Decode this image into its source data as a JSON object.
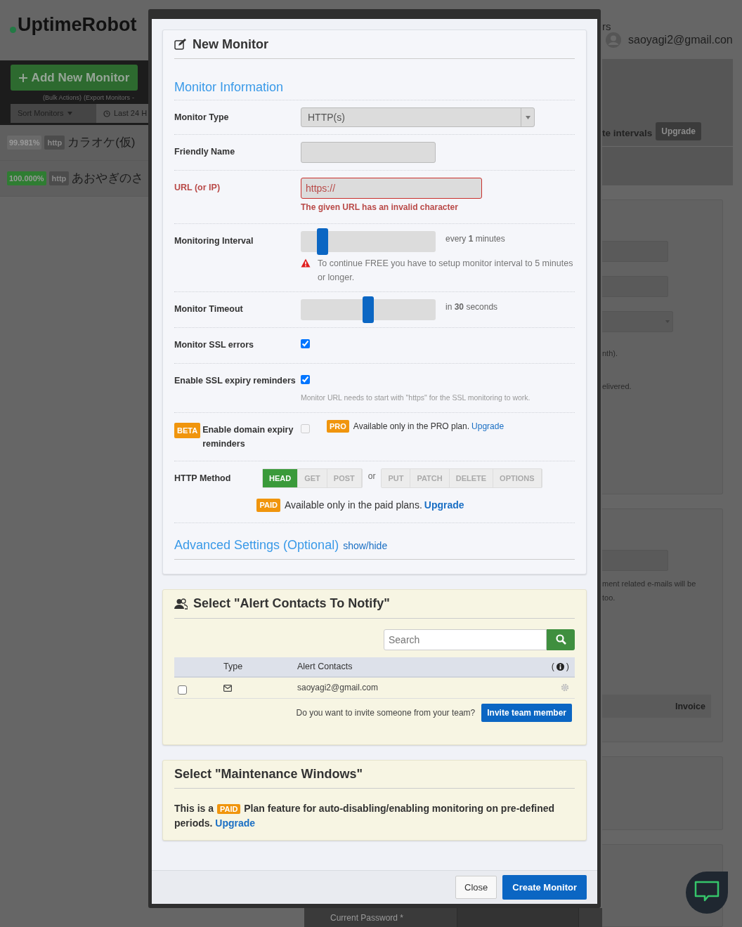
{
  "background": {
    "logo": "UptimeRobot",
    "add_button": "Add New Monitor",
    "links": [
      "(Bulk Actions)",
      "(Export Monitors"
    ],
    "link_separator": "-",
    "sort_label": "Sort Monitors",
    "range_label": "Last 24 H",
    "monitors": [
      {
        "uptime": "99.981%",
        "type": "http",
        "name": "カラオケ(仮)",
        "color": "#6a6a6a"
      },
      {
        "uptime": "100.000%",
        "type": "http",
        "name": "あおやぎのさ",
        "color": "#2f7d32"
      }
    ],
    "header_fragment": "rs",
    "user_email": "saoyagi2@gmail.con",
    "notice": "te intervals",
    "notice_button": "Upgrade",
    "fragments": [
      "nth).",
      "elivered.",
      "ment related e-mails will be",
      "too."
    ],
    "invoice": "Invoice",
    "current_password": "Current Password *"
  },
  "modal": {
    "title": "New Monitor",
    "section": "Monitor Information",
    "rows": [
      {
        "kind": "select",
        "label": "Monitor Type",
        "value": "HTTP(s)"
      },
      {
        "kind": "text",
        "label": "Friendly Name",
        "invalid": false
      },
      {
        "kind": "text",
        "label": "URL (or IP)",
        "value": "https://",
        "invalid": true,
        "error": "The given URL has an invalid character"
      },
      {
        "kind": "slider",
        "label": "Monitoring Interval",
        "level": 0.13,
        "reading": "every **1** minutes",
        "warning": "To continue FREE you have to setup monitor interval to 5 minutes or longer."
      },
      {
        "kind": "slider",
        "label": "Monitor Timeout",
        "level": 0.5,
        "reading": "in **30** seconds"
      },
      {
        "kind": "checkbox",
        "label": "Monitor SSL errors",
        "checked": true,
        "disabled": false
      },
      {
        "kind": "checkbox",
        "label": "Enable SSL expiry reminders",
        "checked": true,
        "disabled": false,
        "note": "Monitor URL needs to start with \"https\" for the SSL monitoring to work."
      },
      {
        "kind": "checkbox",
        "label": "Enable domain expiry reminders",
        "tag": "BETA",
        "checked": false,
        "disabled": true,
        "plan_badge": "PRO",
        "plan_text": "Available only in the PRO plan.",
        "plan_link": "Upgrade"
      },
      {
        "kind": "methods",
        "label": "HTTP Method",
        "groups": [
          [
            {
              "label": "HEAD",
              "selected": true
            },
            {
              "label": "GET",
              "selected": false
            },
            {
              "label": "POST",
              "selected": false
            }
          ],
          [
            {
              "label": "PUT",
              "selected": false
            },
            {
              "label": "PATCH",
              "selected": false
            },
            {
              "label": "DELETE",
              "selected": false
            },
            {
              "label": "OPTIONS",
              "selected": false
            }
          ]
        ],
        "separator": "or",
        "plan_badge": "PAID",
        "plan_text": "Available only in the paid plans.",
        "plan_link": "Upgrade"
      }
    ],
    "advanced": {
      "title": "Advanced Settings (Optional)",
      "toggle": "show/hide"
    },
    "alerts": {
      "title": "Select \"Alert Contacts To Notify\"",
      "search_placeholder": "Search",
      "columns": [
        "Type",
        "Alert Contacts"
      ],
      "info_open": "(",
      "info_close": ")",
      "contacts": [
        {
          "email": "saoyagi2@gmail.com",
          "checked": false
        }
      ],
      "invite_text": "Do you want to invite someone from your team?",
      "invite_button": "Invite team member"
    },
    "maintenance": {
      "title": "Select \"Maintenance Windows\"",
      "text_before": "This is a",
      "badge": "PAID",
      "text_after": "Plan feature for auto-disabling/enabling monitoring on pre-defined periods.",
      "link": "Upgrade"
    },
    "buttons": [
      "Close",
      "Create Monitor"
    ]
  }
}
